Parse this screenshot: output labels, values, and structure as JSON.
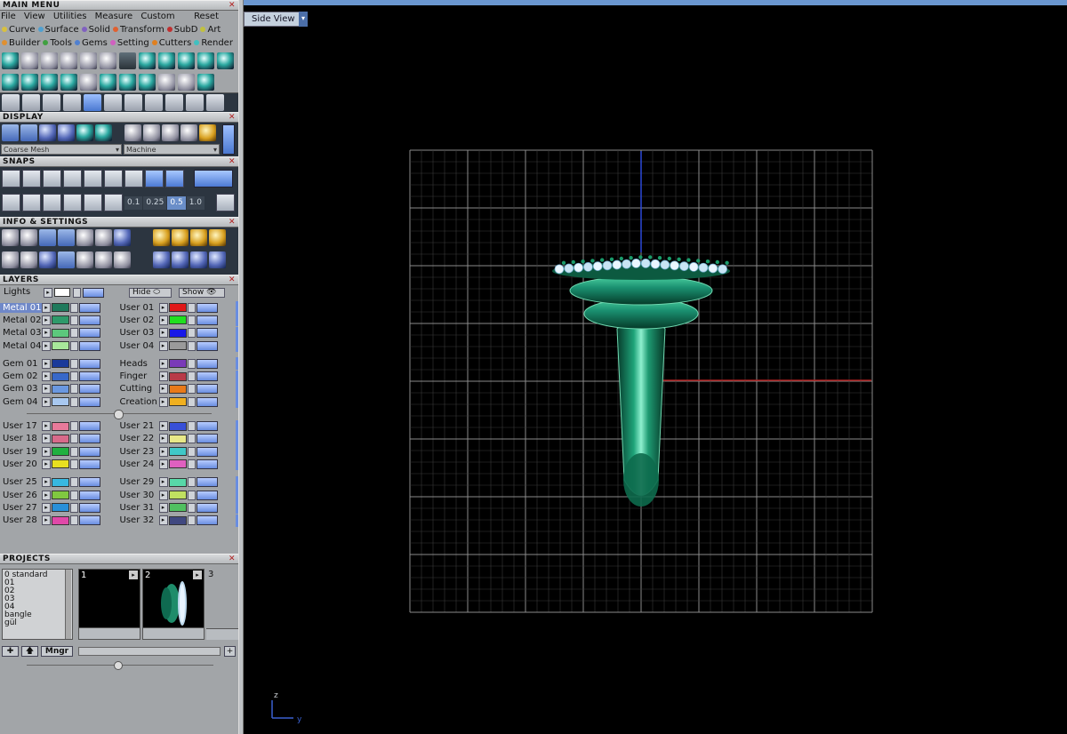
{
  "main_menu": {
    "title": "MAIN MENU",
    "menus": [
      "File",
      "View",
      "Utilities",
      "Measure",
      "Custom"
    ],
    "reset": "Reset",
    "categories_row1": [
      {
        "label": "Curve",
        "color": "#d8c040"
      },
      {
        "label": "Surface",
        "color": "#50a0d0"
      },
      {
        "label": "Solid",
        "color": "#8060c0"
      },
      {
        "label": "Transform",
        "color": "#e06030"
      },
      {
        "label": "SubD",
        "color": "#c03030"
      },
      {
        "label": "Art",
        "color": "#c0c040"
      }
    ],
    "categories_row2": [
      {
        "label": "Builder",
        "color": "#e09030"
      },
      {
        "label": "Tools",
        "color": "#40a040"
      },
      {
        "label": "Gems",
        "color": "#5080d0"
      },
      {
        "label": "Setting",
        "color": "#d060c0"
      },
      {
        "label": "Cutters",
        "color": "#e08020"
      },
      {
        "label": "Render",
        "color": "#40c0c0"
      }
    ]
  },
  "display": {
    "title": "DISPLAY",
    "mesh_select": "Coarse Mesh",
    "material_select": "Machine"
  },
  "snaps": {
    "title": "SNAPS",
    "values": [
      "0.1",
      "0.25",
      "0.5",
      "1.0"
    ],
    "active_value": "0.5"
  },
  "info": {
    "title": "INFO & SETTINGS"
  },
  "layers": {
    "title": "LAYERS",
    "lights": "Lights",
    "hide": "Hide",
    "show": "Show",
    "groups": [
      {
        "left": [
          {
            "name": "Metal 01",
            "color": "#1f7a5c",
            "selected": true
          },
          {
            "name": "Metal 02",
            "color": "#2e9a6a"
          },
          {
            "name": "Metal 03",
            "color": "#5cc87c"
          },
          {
            "name": "Metal 04",
            "color": "#a8e89a"
          }
        ],
        "right": [
          {
            "name": "User 01",
            "color": "#e01818"
          },
          {
            "name": "User 02",
            "color": "#20e020"
          },
          {
            "name": "User 03",
            "color": "#1818e8"
          },
          {
            "name": "User 04",
            "color": "#9a9a9a"
          }
        ]
      },
      {
        "left": [
          {
            "name": "Gem 01",
            "color": "#1a3a9a"
          },
          {
            "name": "Gem 02",
            "color": "#3868c8"
          },
          {
            "name": "Gem 03",
            "color": "#6a98e0"
          },
          {
            "name": "Gem 04",
            "color": "#a8c8f0"
          }
        ],
        "right": [
          {
            "name": "Heads",
            "color": "#7a3ab8"
          },
          {
            "name": "Finger",
            "color": "#b83a48"
          },
          {
            "name": "Cutting",
            "color": "#e87a1a"
          },
          {
            "name": "Creation",
            "color": "#f0b020"
          }
        ]
      },
      {
        "left": [
          {
            "name": "User 17",
            "color": "#e87a9a"
          },
          {
            "name": "User 18",
            "color": "#d86a8a"
          },
          {
            "name": "User 19",
            "color": "#20b040"
          },
          {
            "name": "User 20",
            "color": "#e8e020"
          }
        ],
        "right": [
          {
            "name": "User 21",
            "color": "#3850d8"
          },
          {
            "name": "User 22",
            "color": "#e8e888"
          },
          {
            "name": "User 23",
            "color": "#40c8c8"
          },
          {
            "name": "User 24",
            "color": "#e060c0"
          }
        ]
      },
      {
        "left": [
          {
            "name": "User 25",
            "color": "#38b8e0"
          },
          {
            "name": "User 26",
            "color": "#80c840"
          },
          {
            "name": "User 27",
            "color": "#2890d8"
          },
          {
            "name": "User 28",
            "color": "#e048a8"
          }
        ],
        "right": [
          {
            "name": "User 29",
            "color": "#58d8a8"
          },
          {
            "name": "User 30",
            "color": "#c0e060"
          },
          {
            "name": "User 31",
            "color": "#50c060"
          },
          {
            "name": "User 32",
            "color": "#404880"
          }
        ]
      }
    ]
  },
  "projects": {
    "title": "PROJECTS",
    "list": [
      "0 standard",
      "01",
      "02",
      "03",
      "04",
      "bangle",
      "gül"
    ],
    "slots": [
      "1",
      "2",
      "3"
    ],
    "mngr": "Mngr"
  },
  "viewport": {
    "view_label": "Side View",
    "axis_z": "z",
    "axis_y": "y"
  }
}
